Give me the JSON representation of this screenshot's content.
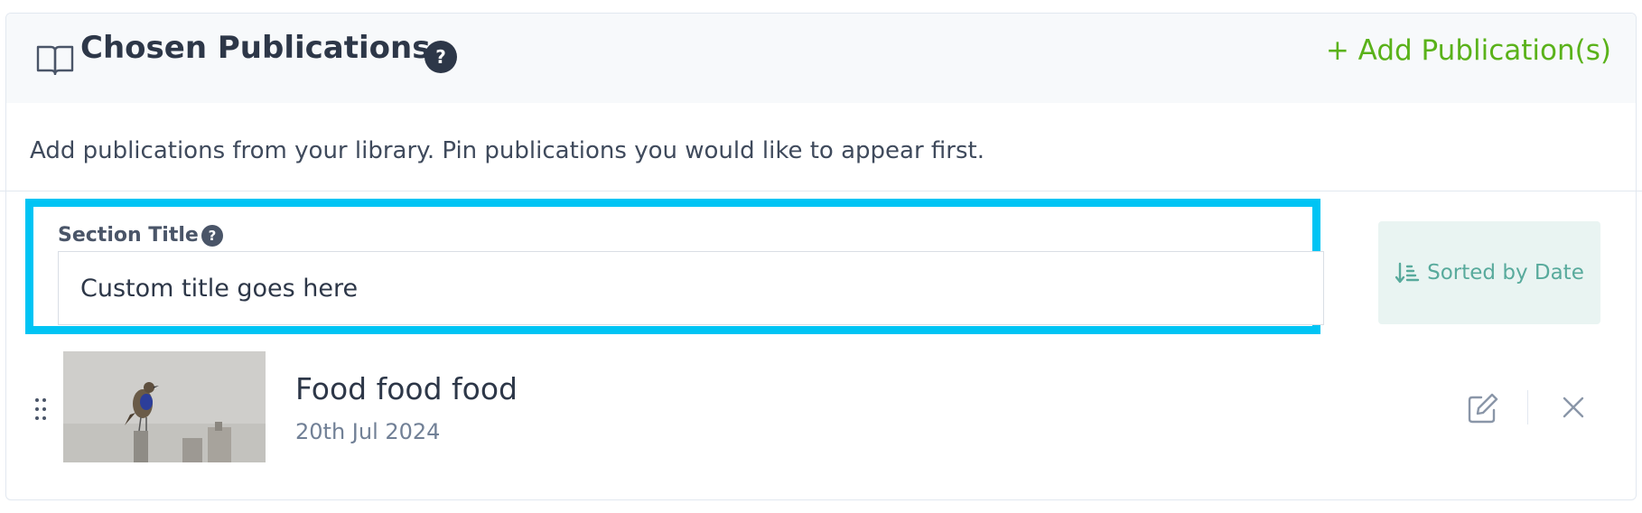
{
  "header": {
    "title": "Chosen Publications",
    "help_glyph": "?",
    "add_label": "+ Add Publication(s)",
    "icon": "book-open-icon"
  },
  "description": "Add publications from your library. Pin publications you would like to appear first.",
  "section_title_field": {
    "label": "Section Title",
    "help_glyph": "?",
    "value": "",
    "placeholder": "Custom title goes here"
  },
  "sort": {
    "label": "Sorted by Date",
    "icon": "sort-descending-icon"
  },
  "publications": [
    {
      "title": "Food food food",
      "date": "20th Jul 2024",
      "thumbnail": "bird-photo"
    }
  ],
  "colors": {
    "accent_green": "#5ab21a",
    "highlight_blue": "#00c4f4",
    "sort_teal": "#58aa9c",
    "heading": "#2d3748"
  }
}
